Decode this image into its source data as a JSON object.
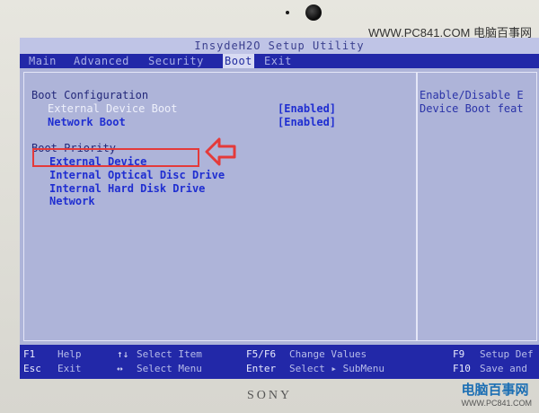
{
  "watermark_top": "WWW.PC841.COM 电脑百事网",
  "title": "InsydeH2O Setup Utility",
  "menu": [
    "Main",
    "Advanced",
    "Security",
    "Boot",
    "Exit"
  ],
  "boot_config": {
    "heading": "Boot Configuration",
    "items": [
      {
        "label": "External Device Boot",
        "value": "[Enabled]"
      },
      {
        "label": "Network Boot",
        "value": "[Enabled]"
      }
    ]
  },
  "boot_priority": {
    "heading": "Boot Priority",
    "items": [
      "External Device",
      "Internal Optical Disc Drive",
      "Internal Hard Disk Drive",
      "Network"
    ]
  },
  "help": [
    "Enable/Disable E",
    "Device Boot feat"
  ],
  "footer": {
    "row1": [
      {
        "key": "F1",
        "desc": "Help"
      },
      {
        "key": "↑↓",
        "desc": "Select Item"
      },
      {
        "key": "F5/F6",
        "desc": "Change Values"
      },
      {
        "key": "F9",
        "desc": "Setup Def"
      }
    ],
    "row2": [
      {
        "key": "Esc",
        "desc": "Exit"
      },
      {
        "key": "↔",
        "desc": "Select Menu"
      },
      {
        "key": "Enter",
        "desc": "Select ▸ SubMenu"
      },
      {
        "key": "F10",
        "desc": "Save and"
      }
    ]
  },
  "brand": "SONY",
  "logo": {
    "name": "电脑百事网",
    "url": "WWW.PC841.COM"
  },
  "colors": {
    "highlight": "#e43a3a",
    "menubar": "#2228a8",
    "screen": "#aeb4d9"
  }
}
